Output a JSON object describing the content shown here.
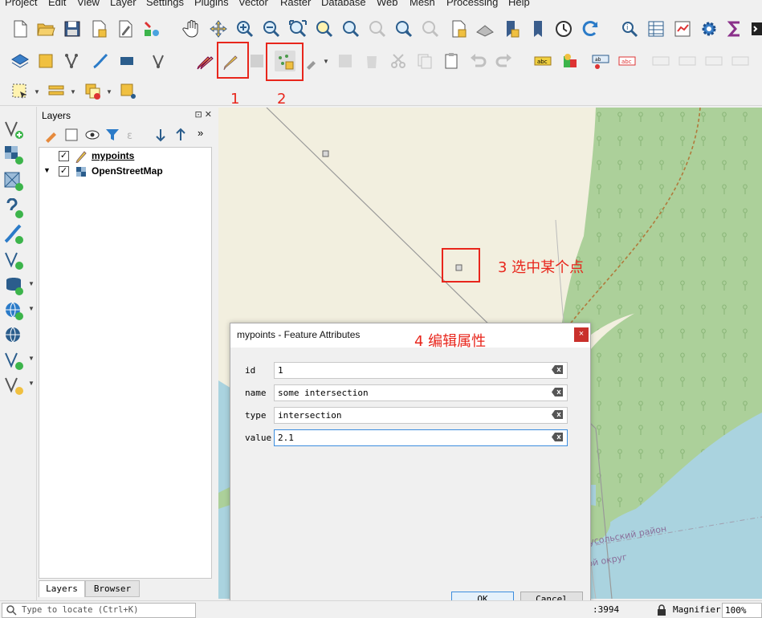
{
  "menu": [
    "Project",
    "Edit",
    "View",
    "Layer",
    "Settings",
    "Plugins",
    "Vector",
    "Raster",
    "Database",
    "Web",
    "Mesh",
    "Processing",
    "Help"
  ],
  "layers_panel": {
    "title": "Layers",
    "controls": "⊡ ✕",
    "layers": [
      {
        "name": "mypoints",
        "checked": "✓"
      },
      {
        "name": "OpenStreetMap",
        "checked": "✓"
      }
    ],
    "tabs": [
      "Layers",
      "Browser"
    ]
  },
  "annotations": {
    "n1": "1",
    "n2": "2",
    "n3": "3 选中某个点",
    "n4": "4 编辑属性"
  },
  "dialog": {
    "title": "mypoints - Feature Attributes",
    "close": "×",
    "fields": [
      {
        "label": "id",
        "value": "1"
      },
      {
        "label": "name",
        "value": "some intersection"
      },
      {
        "label": "type",
        "value": "intersection"
      },
      {
        "label": "value",
        "value": "2.1"
      }
    ],
    "ok": "OK",
    "cancel": "Cancel"
  },
  "map": {
    "labels": [
      "усольский район",
      "ой округ"
    ]
  },
  "statusbar": {
    "locate_placeholder": "Type to locate (Ctrl+K)",
    "scale_fragment": ":3994",
    "magnifier_label": "Magnifier",
    "magnifier_value": "100%"
  },
  "colors": {
    "annotation_red": "#e8261c",
    "map_land": "#f2efdf",
    "map_forest": "#acd09a",
    "map_water": "#aad3df",
    "focus_blue": "#3c8dde"
  }
}
